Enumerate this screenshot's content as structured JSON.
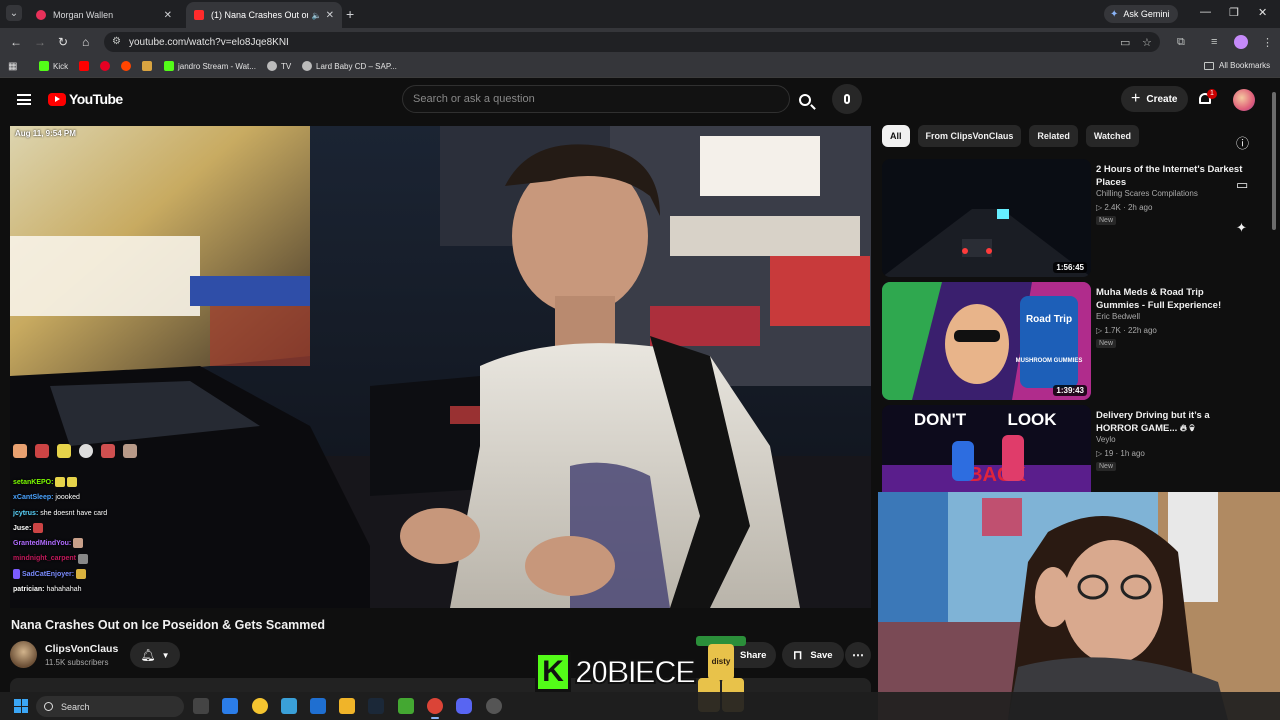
{
  "browser": {
    "tabs": [
      {
        "title": "Morgan Wallen",
        "active": false
      },
      {
        "title": "(1) Nana Crashes Out on Ic",
        "active": true
      }
    ],
    "gemini_label": "Ask Gemini",
    "url": "youtube.com/watch?v=elo8Jqe8KNI",
    "bookmarks": [
      {
        "label": "Kick",
        "icon": "kick-icon",
        "color": "#53fc18"
      },
      {
        "label": "",
        "icon": "youtube-icon",
        "color": "#ff0000"
      },
      {
        "label": "",
        "icon": "pinterest-icon",
        "color": "#e60023"
      },
      {
        "label": "",
        "icon": "reddit-icon",
        "color": "#ff4500"
      },
      {
        "label": "",
        "icon": "game-icon",
        "color": "#d9a441"
      },
      {
        "label": "jandro Stream - Wat...",
        "icon": "kick-icon",
        "color": "#53fc18"
      },
      {
        "label": "TV",
        "icon": "globe-icon",
        "color": "#bbbbbb"
      },
      {
        "label": "Lard Baby CD – SAP...",
        "icon": "globe-icon",
        "color": "#bbbbbb"
      }
    ],
    "all_bookmarks": "All Bookmarks"
  },
  "youtube": {
    "logo_text": "YouTube",
    "search_placeholder": "Search or ask a question",
    "create_label": "Create",
    "notification_count": "1"
  },
  "video": {
    "stream_date": "Aug 11, 9:54 PM",
    "title": "Nana Crashes Out on Ice Poseidon & Gets Scammed",
    "channel": "ClipsVonClaus",
    "subscribers": "11.5K subscribers",
    "share_label": "Share",
    "save_label": "Save",
    "chat": [
      {
        "user": "setanKEPO:",
        "msg": "",
        "color": "#7CFC00"
      },
      {
        "user": "xCantSleep:",
        "msg": "joooked",
        "color": "#4aa3ff"
      },
      {
        "user": "jcytrus:",
        "msg": "she doesnt have card",
        "color": "#5bd6ff"
      },
      {
        "user": "Juse:",
        "msg": "",
        "color": "#ffffff"
      },
      {
        "user": "GrantedMindYou:",
        "msg": "",
        "color": "#b06bff"
      },
      {
        "user": "mindnight_carpent",
        "msg": "",
        "color": "#c2185b"
      },
      {
        "user": "SadCatEnjoyer:",
        "msg": "",
        "color": "#7b8cff"
      },
      {
        "user": "patrician:",
        "msg": "hahahahah",
        "color": "#ffffff"
      }
    ],
    "overlay_name": "20BIECE",
    "overlay_can_text": "disty"
  },
  "sidebar": {
    "chips": [
      "All",
      "From ClipsVonClaus",
      "Related",
      "Watched"
    ],
    "recommendations": [
      {
        "title": "2 Hours of the Internet's Darkest Places",
        "channel": "Chilling Scares Compilations",
        "views": "2.4K",
        "age": "2h ago",
        "badge": "New",
        "duration": "1:56:45"
      },
      {
        "title": "Muha Meds & Road Trip Gummies - Full Experience!",
        "channel": "Eric Bedwell",
        "views": "1.7K",
        "age": "22h ago",
        "badge": "New",
        "duration": "1:39:43"
      },
      {
        "title": "Delivery Driving but it’s a HORROR GAME...",
        "channel": "Veylo",
        "views": "19",
        "age": "1h ago",
        "badge": "New",
        "duration": ""
      }
    ],
    "thumb_texts": {
      "road_trip": "Road Trip",
      "mushroom": "MUSHROOM GUMMIES",
      "dont": "DON'T",
      "look": "LOOK",
      "back": "BACK"
    }
  },
  "taskbar": {
    "search_label": "Search"
  }
}
